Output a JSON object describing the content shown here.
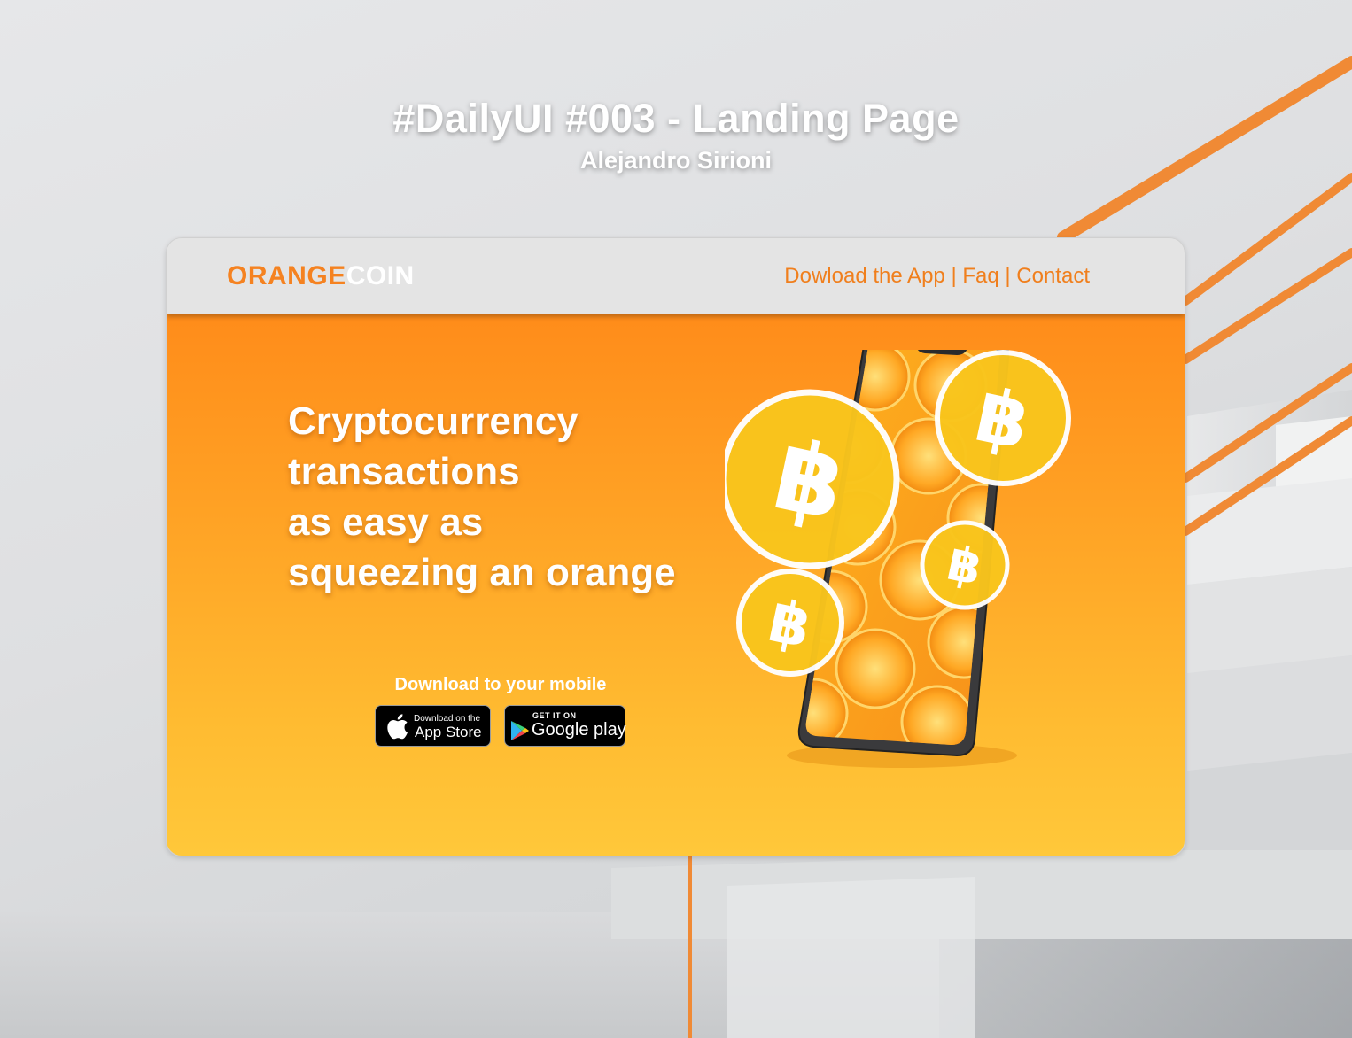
{
  "header": {
    "title": "#DailyUI #003 - Landing Page",
    "author": "Alejandro Sirioni"
  },
  "navbar": {
    "logo_part1": "ORANGE",
    "logo_part2": "COIN",
    "links": [
      "Dowload the App",
      "Faq",
      "Contact"
    ],
    "separator": "|"
  },
  "hero": {
    "headline_lines": [
      "Cryptocurrency",
      "transactions",
      "as easy as",
      "squeezing an orange"
    ],
    "download_label": "Download to your mobile",
    "app_store": {
      "small": "Download on the",
      "big": "App Store"
    },
    "google_play": {
      "small": "GET IT ON",
      "big": "Google play"
    }
  },
  "icons": {
    "apple": "apple-icon",
    "google_play": "google-play-icon",
    "coin": "bitcoin-icon"
  },
  "colors": {
    "brand_orange": "#f58220",
    "nav_link": "#f07f1d",
    "hero_top": "#ff8c1a",
    "hero_bottom": "#ffc83a",
    "coin_fill": "#f9c51c"
  }
}
